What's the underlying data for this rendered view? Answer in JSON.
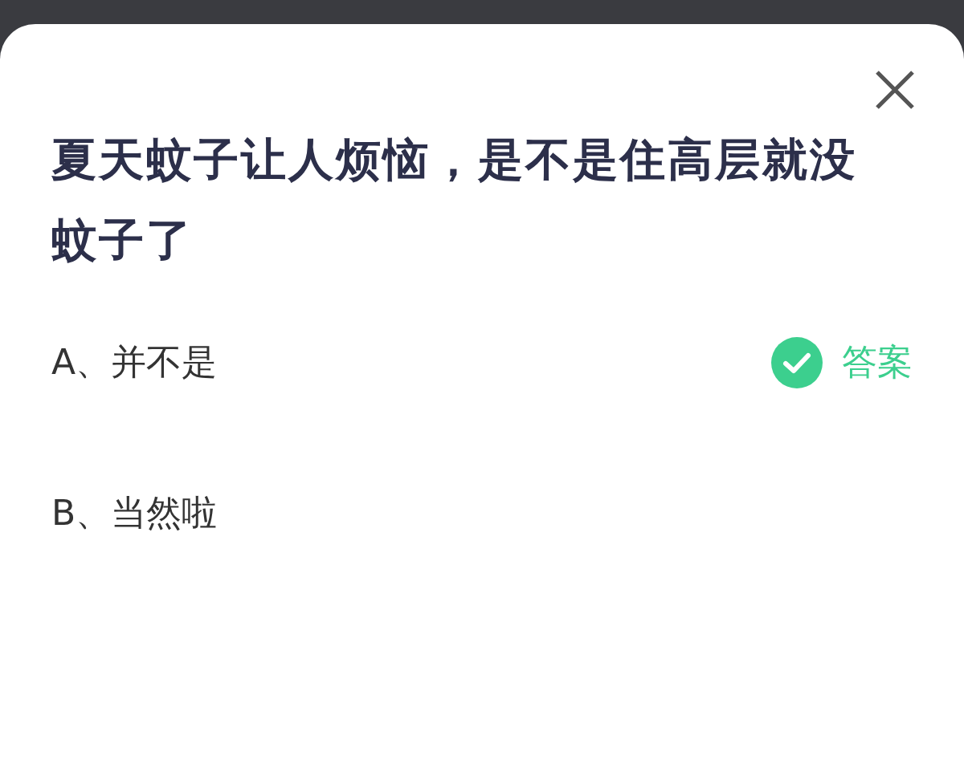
{
  "question": "夏天蚊子让人烦恼，是不是住高层就没蚊子了",
  "options": [
    {
      "label": "A、并不是",
      "correct": true
    },
    {
      "label": "B、当然啦",
      "correct": false
    }
  ],
  "answer_label": "答案"
}
